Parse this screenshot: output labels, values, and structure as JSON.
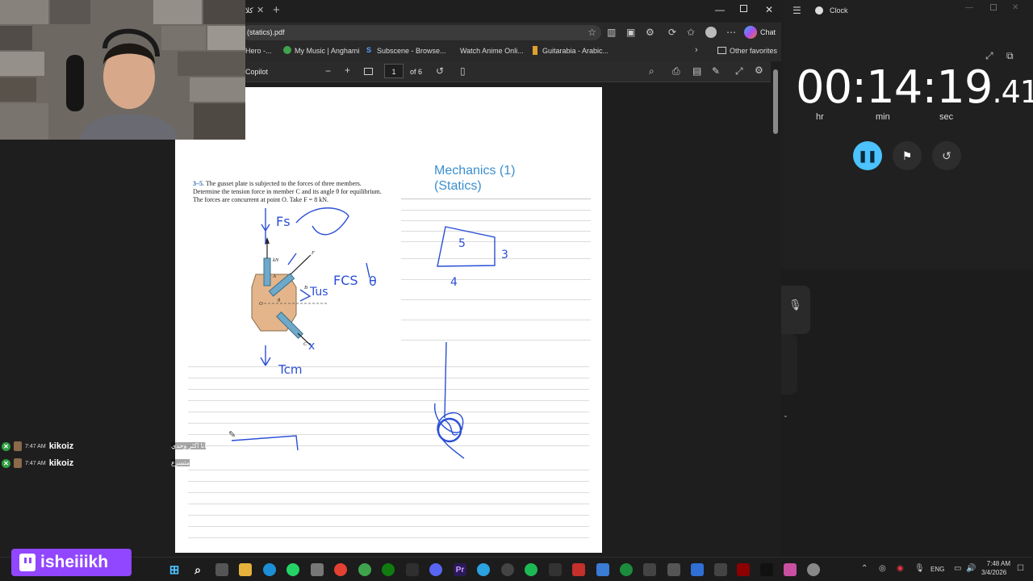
{
  "browser": {
    "tab_title": "كلا",
    "address": "(statics).pdf",
    "chat_label": "Chat",
    "bookmarks": [
      "Hero -...",
      "My Music | Anghami",
      "Subscene - Browse...",
      "Watch Anime Onli...",
      "Guitarabia - Arabic...",
      "Other favorites"
    ],
    "pdf": {
      "copilot_label": "Copilot",
      "page_number": "1",
      "page_total": "of 6"
    }
  },
  "document": {
    "problem_number": "3–5.",
    "problem_text": "The gusset plate is subjected to the forces of three members. Determine the tension force in member C and its angle θ for equilibrium. The forces are concurrent at point O. Take F = 8 kN.",
    "mech_title": "Mechanics (1) (Statics)",
    "figure_labels": {
      "kn": "kN",
      "a": "A",
      "b": "B",
      "c": "C",
      "f": "F",
      "o": "O",
      "theta": "θ"
    },
    "handwriting": {
      "fs": "Fs",
      "fcs": "FCS",
      "tus": "Tus",
      "tcm": "Tcm",
      "tri_top": "5",
      "tri_right": "3",
      "tri_bottom": "4"
    }
  },
  "chat": [
    {
      "time": "7:47 AM",
      "user": "kikoiz",
      "message": "أنا اكثر وحدي"
    },
    {
      "time": "7:47 AM",
      "user": "kikoiz",
      "message": "متسرع"
    }
  ],
  "clock": {
    "app_title": "Clock",
    "hours": "00",
    "minutes": "14",
    "seconds": "19",
    "hundredths": ".41",
    "unit_hr": "hr",
    "unit_min": "min",
    "unit_sec": "sec"
  },
  "stream": {
    "channel": "isheiiikh"
  },
  "taskbar": {
    "lang": "ENG",
    "time": "7:48 AM",
    "date": "3/4/2026"
  }
}
